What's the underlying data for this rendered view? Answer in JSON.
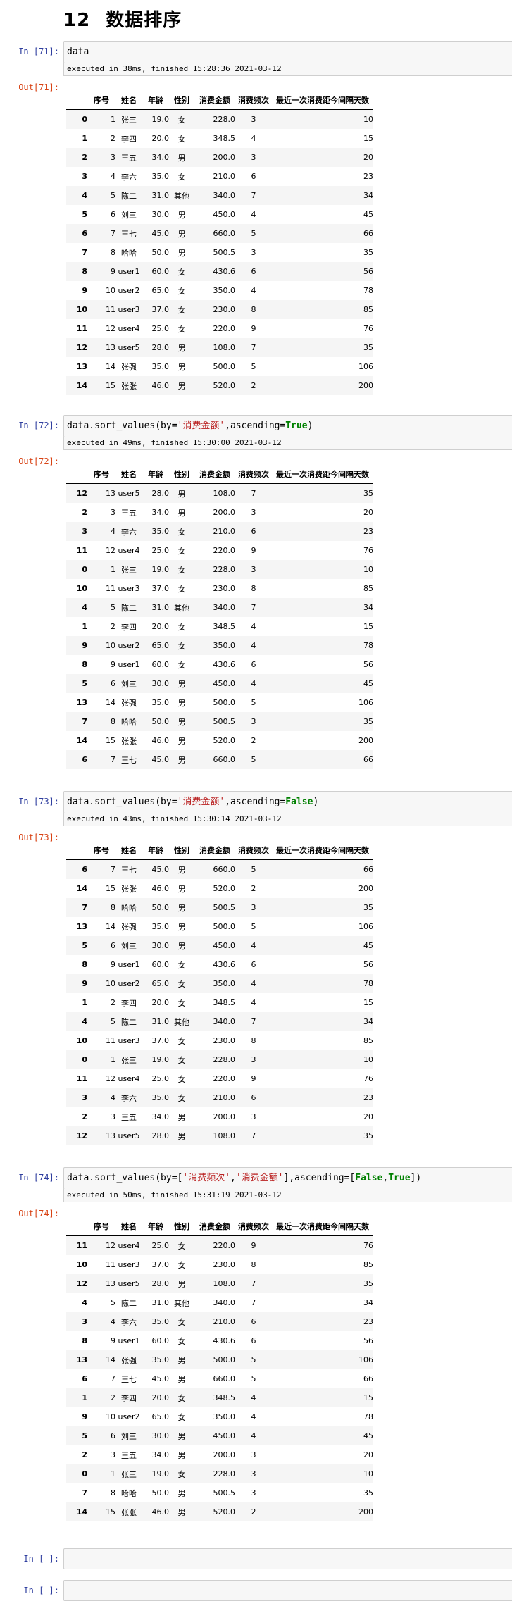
{
  "heading": {
    "number": "12",
    "title": "数据排序"
  },
  "columns": [
    "",
    "序号",
    "姓名",
    "年龄",
    "性别",
    "消费金额",
    "消费频次",
    "最近一次消费距今间隔天数"
  ],
  "cells": [
    {
      "in_prompt": "In [71]:",
      "code": [
        {
          "t": "data",
          "c": ""
        }
      ],
      "exec": "executed in 38ms, finished 15:28:36 2021-03-12",
      "out_prompt": "Out[71]:",
      "rows": [
        [
          "0",
          "1",
          "张三",
          "19.0",
          "女",
          "228.0",
          "3",
          "10"
        ],
        [
          "1",
          "2",
          "李四",
          "20.0",
          "女",
          "348.5",
          "4",
          "15"
        ],
        [
          "2",
          "3",
          "王五",
          "34.0",
          "男",
          "200.0",
          "3",
          "20"
        ],
        [
          "3",
          "4",
          "李六",
          "35.0",
          "女",
          "210.0",
          "6",
          "23"
        ],
        [
          "4",
          "5",
          "陈二",
          "31.0",
          "其他",
          "340.0",
          "7",
          "34"
        ],
        [
          "5",
          "6",
          "刘三",
          "30.0",
          "男",
          "450.0",
          "4",
          "45"
        ],
        [
          "6",
          "7",
          "王七",
          "45.0",
          "男",
          "660.0",
          "5",
          "66"
        ],
        [
          "7",
          "8",
          "哈哈",
          "50.0",
          "男",
          "500.5",
          "3",
          "35"
        ],
        [
          "8",
          "9",
          "user1",
          "60.0",
          "女",
          "430.6",
          "6",
          "56"
        ],
        [
          "9",
          "10",
          "user2",
          "65.0",
          "女",
          "350.0",
          "4",
          "78"
        ],
        [
          "10",
          "11",
          "user3",
          "37.0",
          "女",
          "230.0",
          "8",
          "85"
        ],
        [
          "11",
          "12",
          "user4",
          "25.0",
          "女",
          "220.0",
          "9",
          "76"
        ],
        [
          "12",
          "13",
          "user5",
          "28.0",
          "男",
          "108.0",
          "7",
          "35"
        ],
        [
          "13",
          "14",
          "张强",
          "35.0",
          "男",
          "500.0",
          "5",
          "106"
        ],
        [
          "14",
          "15",
          "张张",
          "46.0",
          "男",
          "520.0",
          "2",
          "200"
        ]
      ]
    },
    {
      "in_prompt": "In [72]:",
      "code": [
        {
          "t": "data.sort_values(by=",
          "c": ""
        },
        {
          "t": "'消费金额'",
          "c": "str"
        },
        {
          "t": ",ascending=",
          "c": ""
        },
        {
          "t": "True",
          "c": "kw"
        },
        {
          "t": ")",
          "c": ""
        }
      ],
      "exec": "executed in 49ms, finished 15:30:00 2021-03-12",
      "out_prompt": "Out[72]:",
      "rows": [
        [
          "12",
          "13",
          "user5",
          "28.0",
          "男",
          "108.0",
          "7",
          "35"
        ],
        [
          "2",
          "3",
          "王五",
          "34.0",
          "男",
          "200.0",
          "3",
          "20"
        ],
        [
          "3",
          "4",
          "李六",
          "35.0",
          "女",
          "210.0",
          "6",
          "23"
        ],
        [
          "11",
          "12",
          "user4",
          "25.0",
          "女",
          "220.0",
          "9",
          "76"
        ],
        [
          "0",
          "1",
          "张三",
          "19.0",
          "女",
          "228.0",
          "3",
          "10"
        ],
        [
          "10",
          "11",
          "user3",
          "37.0",
          "女",
          "230.0",
          "8",
          "85"
        ],
        [
          "4",
          "5",
          "陈二",
          "31.0",
          "其他",
          "340.0",
          "7",
          "34"
        ],
        [
          "1",
          "2",
          "李四",
          "20.0",
          "女",
          "348.5",
          "4",
          "15"
        ],
        [
          "9",
          "10",
          "user2",
          "65.0",
          "女",
          "350.0",
          "4",
          "78"
        ],
        [
          "8",
          "9",
          "user1",
          "60.0",
          "女",
          "430.6",
          "6",
          "56"
        ],
        [
          "5",
          "6",
          "刘三",
          "30.0",
          "男",
          "450.0",
          "4",
          "45"
        ],
        [
          "13",
          "14",
          "张强",
          "35.0",
          "男",
          "500.0",
          "5",
          "106"
        ],
        [
          "7",
          "8",
          "哈哈",
          "50.0",
          "男",
          "500.5",
          "3",
          "35"
        ],
        [
          "14",
          "15",
          "张张",
          "46.0",
          "男",
          "520.0",
          "2",
          "200"
        ],
        [
          "6",
          "7",
          "王七",
          "45.0",
          "男",
          "660.0",
          "5",
          "66"
        ]
      ]
    },
    {
      "in_prompt": "In [73]:",
      "code": [
        {
          "t": "data.sort_values(by=",
          "c": ""
        },
        {
          "t": "'消费金额'",
          "c": "str"
        },
        {
          "t": ",ascending=",
          "c": ""
        },
        {
          "t": "False",
          "c": "kw"
        },
        {
          "t": ")",
          "c": ""
        }
      ],
      "exec": "executed in 43ms, finished 15:30:14 2021-03-12",
      "out_prompt": "Out[73]:",
      "rows": [
        [
          "6",
          "7",
          "王七",
          "45.0",
          "男",
          "660.0",
          "5",
          "66"
        ],
        [
          "14",
          "15",
          "张张",
          "46.0",
          "男",
          "520.0",
          "2",
          "200"
        ],
        [
          "7",
          "8",
          "哈哈",
          "50.0",
          "男",
          "500.5",
          "3",
          "35"
        ],
        [
          "13",
          "14",
          "张强",
          "35.0",
          "男",
          "500.0",
          "5",
          "106"
        ],
        [
          "5",
          "6",
          "刘三",
          "30.0",
          "男",
          "450.0",
          "4",
          "45"
        ],
        [
          "8",
          "9",
          "user1",
          "60.0",
          "女",
          "430.6",
          "6",
          "56"
        ],
        [
          "9",
          "10",
          "user2",
          "65.0",
          "女",
          "350.0",
          "4",
          "78"
        ],
        [
          "1",
          "2",
          "李四",
          "20.0",
          "女",
          "348.5",
          "4",
          "15"
        ],
        [
          "4",
          "5",
          "陈二",
          "31.0",
          "其他",
          "340.0",
          "7",
          "34"
        ],
        [
          "10",
          "11",
          "user3",
          "37.0",
          "女",
          "230.0",
          "8",
          "85"
        ],
        [
          "0",
          "1",
          "张三",
          "19.0",
          "女",
          "228.0",
          "3",
          "10"
        ],
        [
          "11",
          "12",
          "user4",
          "25.0",
          "女",
          "220.0",
          "9",
          "76"
        ],
        [
          "3",
          "4",
          "李六",
          "35.0",
          "女",
          "210.0",
          "6",
          "23"
        ],
        [
          "2",
          "3",
          "王五",
          "34.0",
          "男",
          "200.0",
          "3",
          "20"
        ],
        [
          "12",
          "13",
          "user5",
          "28.0",
          "男",
          "108.0",
          "7",
          "35"
        ]
      ]
    },
    {
      "in_prompt": "In [74]:",
      "code": [
        {
          "t": "data.sort_values(by=[",
          "c": ""
        },
        {
          "t": "'消费频次'",
          "c": "str"
        },
        {
          "t": ",",
          "c": ""
        },
        {
          "t": "'消费金额'",
          "c": "str"
        },
        {
          "t": "],ascending=[",
          "c": ""
        },
        {
          "t": "False",
          "c": "kw"
        },
        {
          "t": ",",
          "c": ""
        },
        {
          "t": "True",
          "c": "kw"
        },
        {
          "t": "])",
          "c": ""
        }
      ],
      "exec": "executed in 50ms, finished 15:31:19 2021-03-12",
      "out_prompt": "Out[74]:",
      "rows": [
        [
          "11",
          "12",
          "user4",
          "25.0",
          "女",
          "220.0",
          "9",
          "76"
        ],
        [
          "10",
          "11",
          "user3",
          "37.0",
          "女",
          "230.0",
          "8",
          "85"
        ],
        [
          "12",
          "13",
          "user5",
          "28.0",
          "男",
          "108.0",
          "7",
          "35"
        ],
        [
          "4",
          "5",
          "陈二",
          "31.0",
          "其他",
          "340.0",
          "7",
          "34"
        ],
        [
          "3",
          "4",
          "李六",
          "35.0",
          "女",
          "210.0",
          "6",
          "23"
        ],
        [
          "8",
          "9",
          "user1",
          "60.0",
          "女",
          "430.6",
          "6",
          "56"
        ],
        [
          "13",
          "14",
          "张强",
          "35.0",
          "男",
          "500.0",
          "5",
          "106"
        ],
        [
          "6",
          "7",
          "王七",
          "45.0",
          "男",
          "660.0",
          "5",
          "66"
        ],
        [
          "1",
          "2",
          "李四",
          "20.0",
          "女",
          "348.5",
          "4",
          "15"
        ],
        [
          "9",
          "10",
          "user2",
          "65.0",
          "女",
          "350.0",
          "4",
          "78"
        ],
        [
          "5",
          "6",
          "刘三",
          "30.0",
          "男",
          "450.0",
          "4",
          "45"
        ],
        [
          "2",
          "3",
          "王五",
          "34.0",
          "男",
          "200.0",
          "3",
          "20"
        ],
        [
          "0",
          "1",
          "张三",
          "19.0",
          "女",
          "228.0",
          "3",
          "10"
        ],
        [
          "7",
          "8",
          "哈哈",
          "50.0",
          "男",
          "500.5",
          "3",
          "35"
        ],
        [
          "14",
          "15",
          "张张",
          "46.0",
          "男",
          "520.0",
          "2",
          "200"
        ]
      ]
    }
  ],
  "empty_cells": [
    {
      "in_prompt": "In [ ]:"
    },
    {
      "in_prompt": "In [ ]:"
    }
  ]
}
